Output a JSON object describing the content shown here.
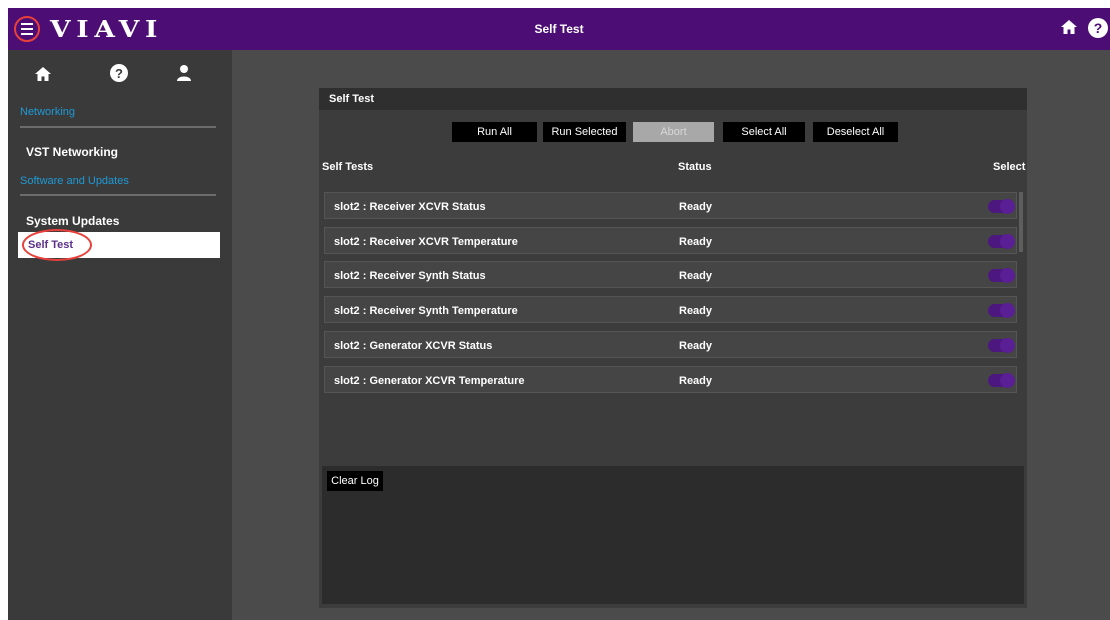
{
  "header": {
    "logo_text": "VIAVI",
    "title": "Self Test",
    "icons": [
      "menu-icon",
      "home-icon",
      "help-icon"
    ]
  },
  "sidebar": {
    "icons": [
      "home-icon",
      "help-icon",
      "user-icon"
    ],
    "section_networking": "Networking",
    "item_vst_networking": "VST Networking",
    "section_software": "Software and Updates",
    "item_system_updates": "System Updates",
    "item_self_test": "Self Test"
  },
  "panel": {
    "title": "Self Test",
    "buttons": {
      "run_all": "Run All",
      "run_selected": "Run Selected",
      "abort": "Abort",
      "select_all": "Select All",
      "deselect_all": "Deselect All"
    },
    "columns": {
      "tests": "Self Tests",
      "status": "Status",
      "select": "Select"
    },
    "tests": [
      {
        "name": "slot2 : Receiver XCVR Status",
        "status": "Ready",
        "selected": true
      },
      {
        "name": "slot2 : Receiver XCVR Temperature",
        "status": "Ready",
        "selected": true
      },
      {
        "name": "slot2 : Receiver Synth Status",
        "status": "Ready",
        "selected": true
      },
      {
        "name": "slot2 : Receiver Synth Temperature",
        "status": "Ready",
        "selected": true
      },
      {
        "name": "slot2 : Generator XCVR Status",
        "status": "Ready",
        "selected": true
      },
      {
        "name": "slot2 : Generator XCVR Temperature",
        "status": "Ready",
        "selected": true
      }
    ],
    "clear_log": "Clear Log"
  },
  "colors": {
    "header_bg": "#4c0e75",
    "toggle_on": "#5a1e95",
    "link_blue": "#1e9ad6",
    "highlight_ring": "#e8403a"
  }
}
